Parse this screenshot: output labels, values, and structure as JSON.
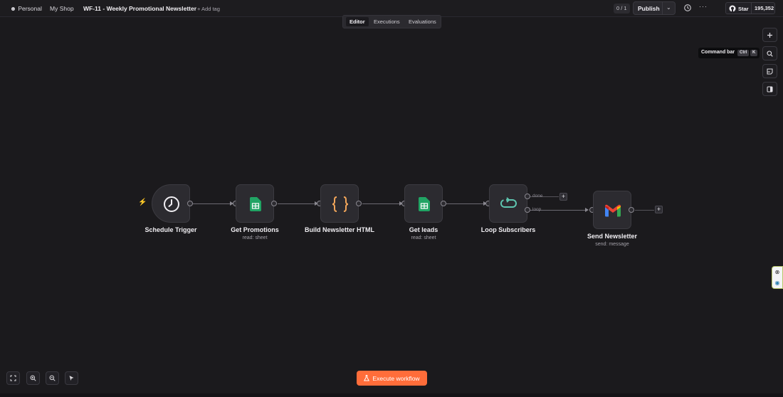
{
  "header": {
    "personal_label": "Personal",
    "project_label": "My Shop",
    "workflow_name": "WF-11 - Weekly Promotional Newsletter",
    "add_tag_label": "+ Add tag",
    "counter": "0 / 1",
    "publish_label": "Publish",
    "github_star_label": "Star",
    "github_star_count": "195,352"
  },
  "tabs": [
    {
      "label": "Editor",
      "active": true
    },
    {
      "label": "Executions",
      "active": false
    },
    {
      "label": "Evaluations",
      "active": false
    }
  ],
  "right_panel": {
    "tooltip_label": "Command bar",
    "shortcut_keys": [
      "Ctrl",
      "K"
    ],
    "icons": [
      "plus-icon",
      "search-icon",
      "sticky-note-icon",
      "panel-icon"
    ]
  },
  "nodes": [
    {
      "name": "Schedule Trigger",
      "subtitle": "",
      "icon": "clock-icon"
    },
    {
      "name": "Get Promotions",
      "subtitle": "read: sheet",
      "icon": "google-sheets-icon"
    },
    {
      "name": "Build Newsletter HTML",
      "subtitle": "",
      "icon": "code-braces-icon"
    },
    {
      "name": "Get leads",
      "subtitle": "read: sheet",
      "icon": "google-sheets-icon"
    },
    {
      "name": "Loop Subscribers",
      "subtitle": "",
      "icon": "loop-icon"
    },
    {
      "name": "Send Newsletter",
      "subtitle": "send: message",
      "icon": "gmail-icon"
    }
  ],
  "branches": {
    "done": "done",
    "loop": "loop"
  },
  "footer": {
    "execute_label": "Execute workflow"
  },
  "colors": {
    "accent": "#ff6d3a",
    "canvas_bg": "#1b1a1d",
    "node_bg": "#2c2b30",
    "sheets_green": "#21a464",
    "code_orange": "#f2a65a",
    "loop_teal": "#5fc6b0"
  }
}
